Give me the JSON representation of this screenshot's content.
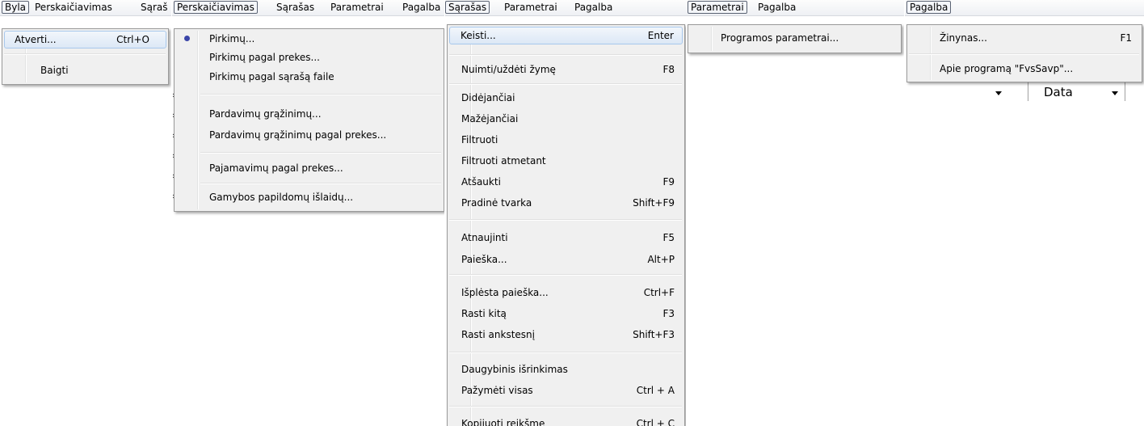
{
  "panel1": {
    "menubar": {
      "file": "Byla",
      "recalc": "Perskaičiavimas",
      "list_cut": "Sąraš"
    },
    "file_menu": [
      {
        "label": "Atverti...",
        "shortcut": "Ctrl+O"
      },
      {
        "label": "Baigti",
        "shortcut": ""
      }
    ]
  },
  "panel2": {
    "menubar": {
      "recalc": "Perskaičiavimas",
      "list": "Sąrašas",
      "params": "Parametrai",
      "help": "Pagalba"
    },
    "recalc_menu": [
      {
        "label": "Pirkimų..."
      },
      {
        "label": "Pirkimų pagal prekes..."
      },
      {
        "label": "Pirkimų pagal sąrašą faile"
      },
      {
        "label": "Pardavimų grąžinimų..."
      },
      {
        "label": "Pardavimų grąžinimų pagal prekes..."
      },
      {
        "label": "Pajamavimų pagal prekes..."
      },
      {
        "label": "Gamybos papildomų išlaidų..."
      }
    ]
  },
  "panel3": {
    "menubar": {
      "list": "Sąrašas",
      "params": "Parametrai",
      "help": "Pagalba"
    },
    "list_menu": [
      {
        "label": "Keisti...",
        "shortcut": "Enter"
      },
      {
        "label": "Nuimti/uždėti žymę",
        "shortcut": "F8"
      },
      {
        "label": "Didėjančiai",
        "shortcut": ""
      },
      {
        "label": "Mažėjančiai",
        "shortcut": ""
      },
      {
        "label": "Filtruoti",
        "shortcut": ""
      },
      {
        "label": "Filtruoti atmetant",
        "shortcut": ""
      },
      {
        "label": "Atšaukti",
        "shortcut": "F9"
      },
      {
        "label": "Pradinė tvarka",
        "shortcut": "Shift+F9"
      },
      {
        "label": "Atnaujinti",
        "shortcut": "F5"
      },
      {
        "label": "Paieška...",
        "shortcut": "Alt+P"
      },
      {
        "label": "Išplėsta paieška...",
        "shortcut": "Ctrl+F"
      },
      {
        "label": "Rasti kitą",
        "shortcut": "F3"
      },
      {
        "label": "Rasti ankstesnį",
        "shortcut": "Shift+F3"
      },
      {
        "label": "Daugybinis išrinkimas",
        "shortcut": ""
      },
      {
        "label": "Pažymėti visas",
        "shortcut": "Ctrl + A"
      },
      {
        "label": "Kopijuoti reikšmę",
        "shortcut": "Ctrl + C"
      }
    ]
  },
  "panel4": {
    "menubar": {
      "params": "Parametrai",
      "help": "Pagalba"
    },
    "params_menu": [
      {
        "label": "Programos parametrai..."
      }
    ]
  },
  "panel5": {
    "menubar": {
      "help": "Pagalba"
    },
    "help_menu": [
      {
        "label": "Žinynas...",
        "shortcut": "F1"
      },
      {
        "label": "Apie programą \"FvsSavp\"...",
        "shortcut": ""
      }
    ],
    "column_header": "Data"
  }
}
